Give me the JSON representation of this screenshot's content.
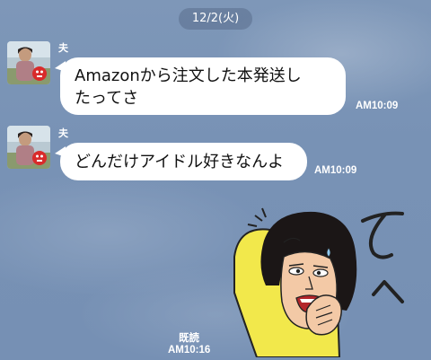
{
  "chat": {
    "date_label": "12/2(火)",
    "messages": [
      {
        "sender": "夫",
        "line1": "Amazonから注文した本発送し",
        "line2": "たってさ",
        "time": "AM10:09"
      },
      {
        "sender": "夫",
        "line1": "どんだけアイドル好きなんよ",
        "time": "AM10:09"
      }
    ],
    "sticker": {
      "icon": "sticker-girl-face-icon",
      "handwriting": "て〜"
    },
    "read_status": "既読",
    "sticker_time": "AM10:16"
  },
  "colors": {
    "background": "#7893b6",
    "bubble": "#ffffff",
    "sticker_yellow": "#f2e84b"
  }
}
